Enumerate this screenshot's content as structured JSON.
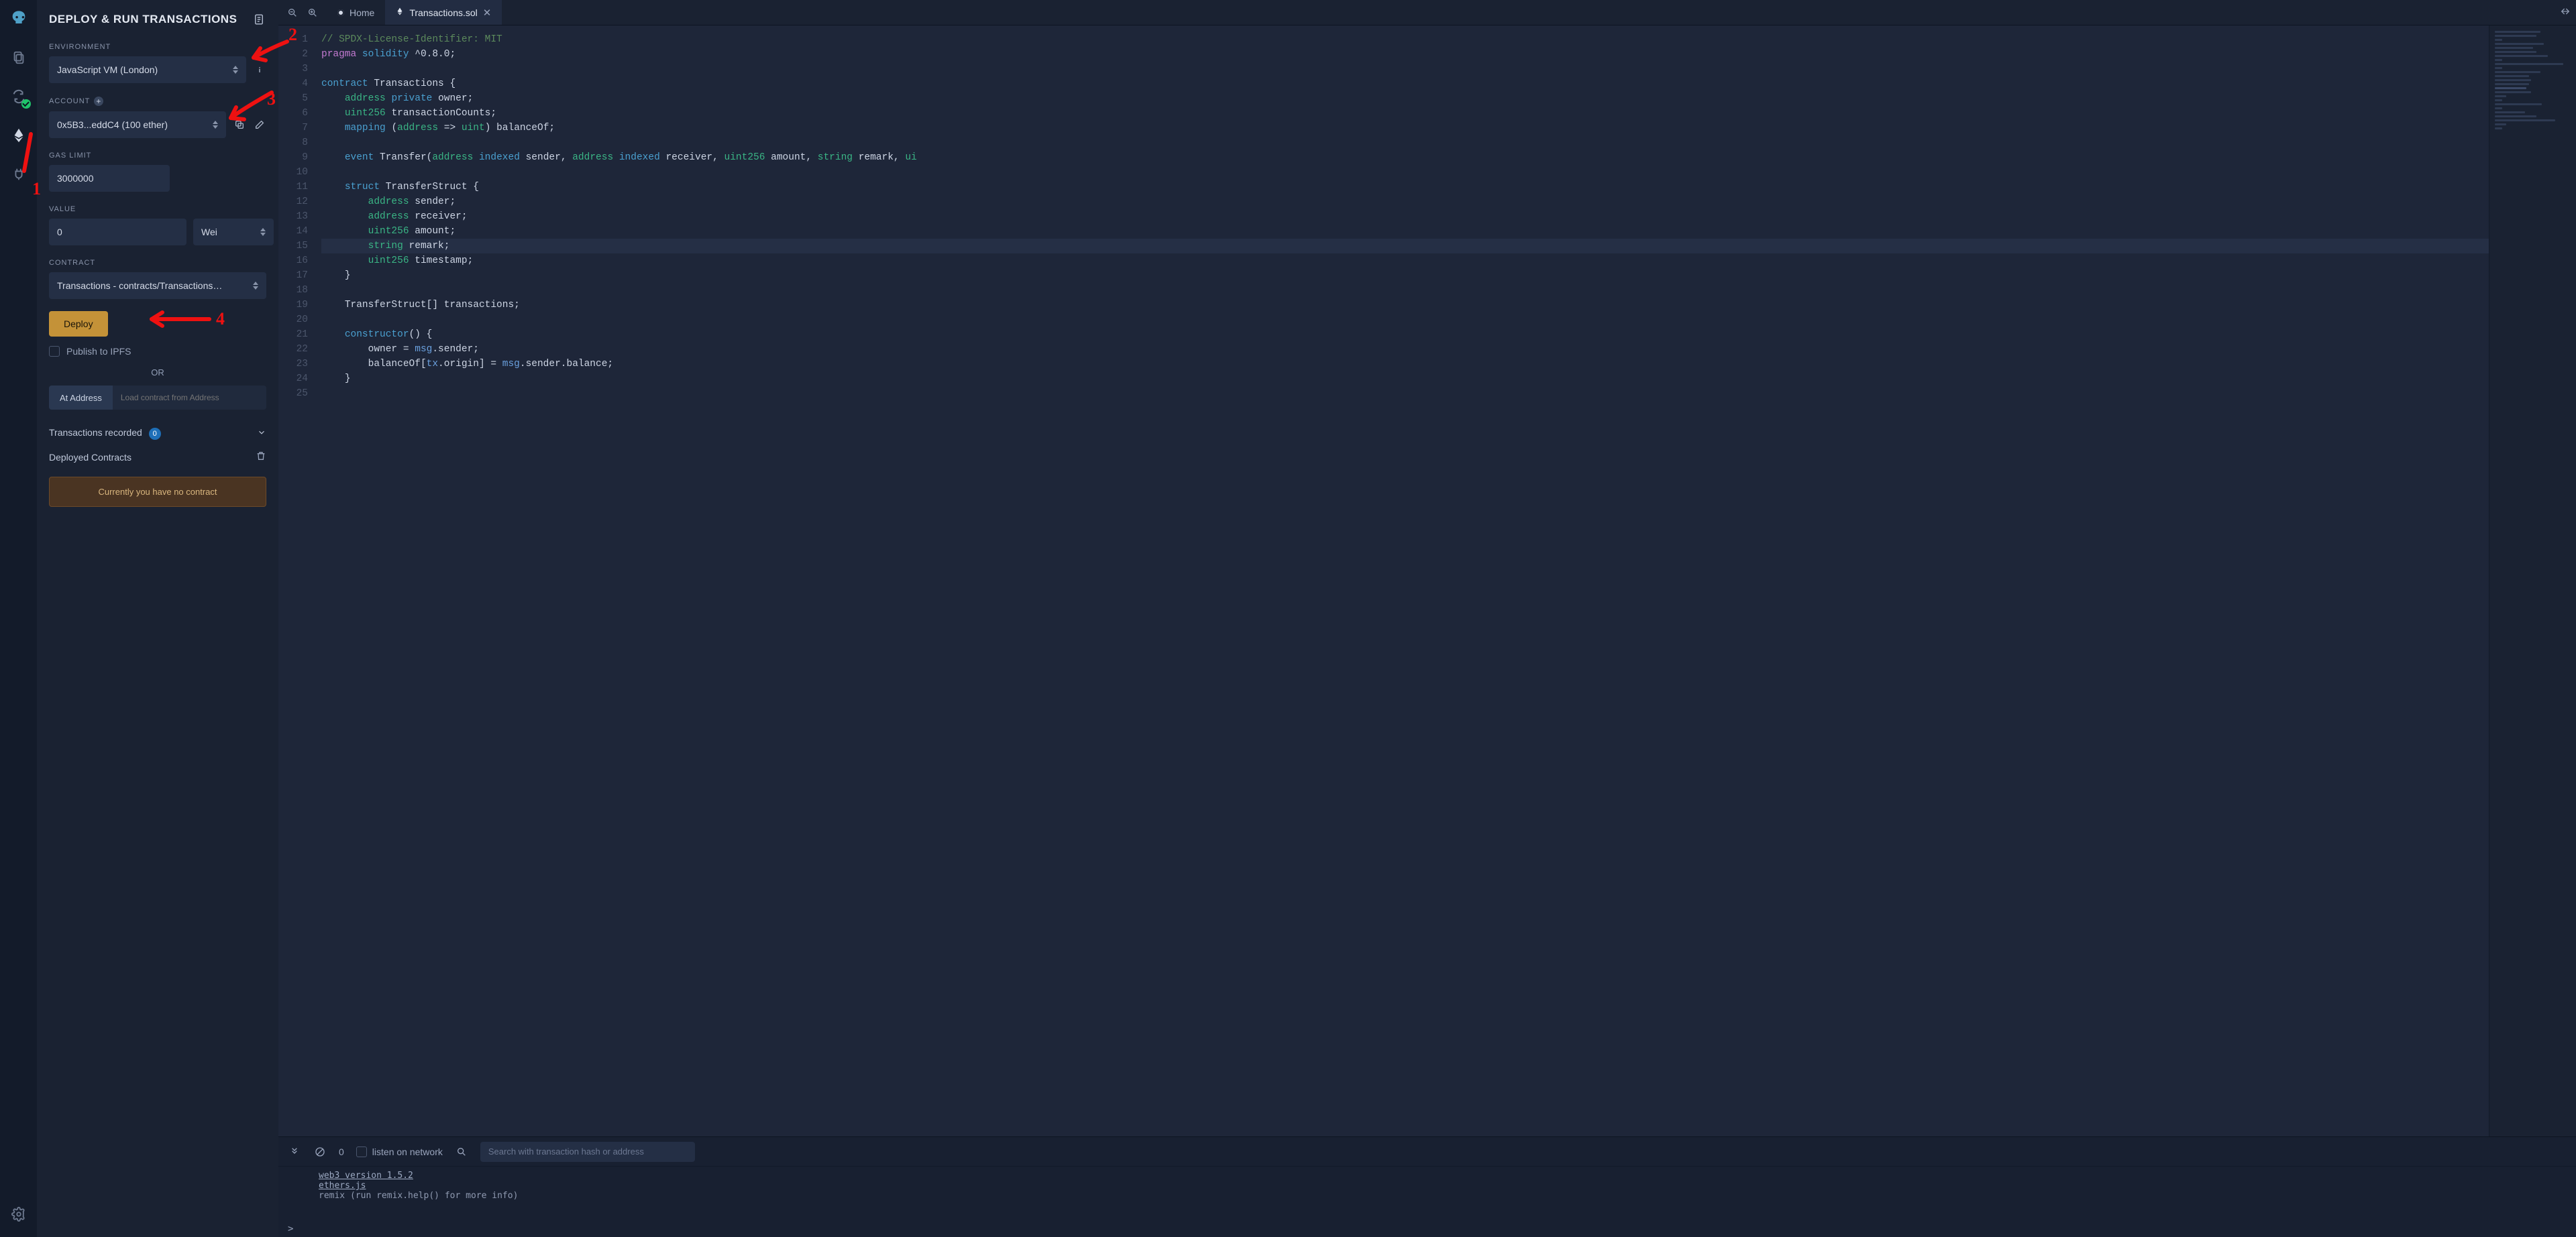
{
  "rail": {
    "items": [
      {
        "name": "logo"
      },
      {
        "name": "file-explorer"
      },
      {
        "name": "compiler"
      },
      {
        "name": "deploy-run",
        "active": true
      },
      {
        "name": "plugin-manager"
      }
    ]
  },
  "panel": {
    "title": "DEPLOY & RUN TRANSACTIONS",
    "environment_label": "ENVIRONMENT",
    "environment_value": "JavaScript VM (London)",
    "account_label": "ACCOUNT",
    "account_value": "0x5B3...eddC4 (100 ether)",
    "gas_limit_label": "GAS LIMIT",
    "gas_limit_value": "3000000",
    "value_label": "VALUE",
    "value_amount": "0",
    "value_unit": "Wei",
    "contract_label": "CONTRACT",
    "contract_value": "Transactions - contracts/Transactions.sol",
    "deploy_label": "Deploy",
    "publish_ipfs_label": "Publish to IPFS",
    "or_label": "OR",
    "at_address_label": "At Address",
    "at_address_placeholder": "Load contract from Address",
    "tx_recorded_label": "Transactions recorded",
    "tx_recorded_count": "0",
    "deployed_contracts_label": "Deployed Contracts",
    "no_contract_msg": "Currently you have no contract"
  },
  "tabs": {
    "home_label": "Home",
    "file_label": "Transactions.sol"
  },
  "editor": {
    "lines": [
      {
        "n": 1,
        "html": "<span class='c-comment'>// SPDX-License-Identifier: MIT</span>"
      },
      {
        "n": 2,
        "html": "<span class='c-kw2'>pragma</span> <span class='c-kw'>solidity</span> <span class='c-ident'>^0.8.0;</span>"
      },
      {
        "n": 3,
        "html": ""
      },
      {
        "n": 4,
        "html": "<span class='c-kw'>contract</span> <span class='c-ident'>Transactions {</span>"
      },
      {
        "n": 5,
        "html": "    <span class='c-type'>address</span> <span class='c-kw'>private</span> <span class='c-ident'>owner;</span>"
      },
      {
        "n": 6,
        "html": "    <span class='c-type'>uint256</span> <span class='c-ident'>transactionCounts;</span>"
      },
      {
        "n": 7,
        "html": "    <span class='c-kw'>mapping</span> <span class='c-punct'>(</span><span class='c-type'>address</span> <span class='c-punct'>=&gt;</span> <span class='c-type'>uint</span><span class='c-punct'>)</span> <span class='c-ident'>balanceOf;</span>"
      },
      {
        "n": 8,
        "html": ""
      },
      {
        "n": 9,
        "html": "    <span class='c-kw'>event</span> <span class='c-ident'>Transfer(</span><span class='c-type'>address</span> <span class='c-kw'>indexed</span> <span class='c-ident'>sender,</span> <span class='c-type'>address</span> <span class='c-kw'>indexed</span> <span class='c-ident'>receiver,</span> <span class='c-type'>uint256</span> <span class='c-ident'>amount,</span> <span class='c-type'>string</span> <span class='c-ident'>remark,</span> <span class='c-type'>ui</span>"
      },
      {
        "n": 10,
        "html": ""
      },
      {
        "n": 11,
        "html": "    <span class='c-kw'>struct</span> <span class='c-ident'>TransferStruct {</span>"
      },
      {
        "n": 12,
        "html": "        <span class='c-type'>address</span> <span class='c-ident'>sender;</span>"
      },
      {
        "n": 13,
        "html": "        <span class='c-type'>address</span> <span class='c-ident'>receiver;</span>"
      },
      {
        "n": 14,
        "html": "        <span class='c-type'>uint256</span> <span class='c-ident'>amount;</span>"
      },
      {
        "n": 15,
        "html": "        <span class='c-type'>string</span> <span class='c-ident'>remark;</span>",
        "hl": true
      },
      {
        "n": 16,
        "html": "        <span class='c-type'>uint256</span> <span class='c-ident'>timestamp;</span>"
      },
      {
        "n": 17,
        "html": "    <span class='c-punct'>}</span>"
      },
      {
        "n": 18,
        "html": ""
      },
      {
        "n": 19,
        "html": "    <span class='c-ident'>TransferStruct[] transactions;</span>"
      },
      {
        "n": 20,
        "html": ""
      },
      {
        "n": 21,
        "html": "    <span class='c-kw'>constructor</span><span class='c-punct'>() {</span>"
      },
      {
        "n": 22,
        "html": "        <span class='c-ident'>owner = </span><span class='c-globals'>msg</span><span class='c-ident'>.sender;</span>"
      },
      {
        "n": 23,
        "html": "        <span class='c-ident'>balanceOf[</span><span class='c-globals'>tx</span><span class='c-ident'>.origin] = </span><span class='c-globals'>msg</span><span class='c-ident'>.sender.balance;</span>"
      },
      {
        "n": 24,
        "html": "    <span class='c-punct'>}</span>"
      },
      {
        "n": 25,
        "html": ""
      }
    ]
  },
  "console": {
    "count": "0",
    "listen_label": "listen on network",
    "search_placeholder": "Search with transaction hash or address",
    "body_lines": [
      {
        "html": "<span class='u'>web3 version 1.5.2</span>"
      },
      {
        "html": "<span class='u'>ethers.js</span>"
      },
      {
        "html": "remix (run remix.help() for more info)"
      }
    ]
  },
  "annotations": {
    "a1": "1",
    "a2": "2",
    "a3": "3",
    "a4": "4"
  }
}
